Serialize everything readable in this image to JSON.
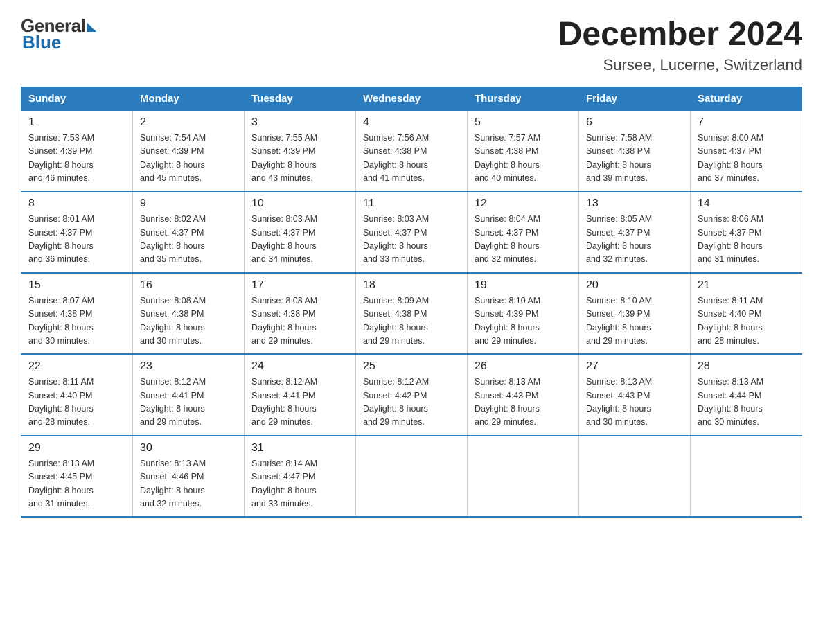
{
  "logo": {
    "general": "General",
    "blue": "Blue"
  },
  "header": {
    "month": "December 2024",
    "location": "Sursee, Lucerne, Switzerland"
  },
  "days_of_week": [
    "Sunday",
    "Monday",
    "Tuesday",
    "Wednesday",
    "Thursday",
    "Friday",
    "Saturday"
  ],
  "weeks": [
    [
      {
        "day": "1",
        "sunrise": "7:53 AM",
        "sunset": "4:39 PM",
        "daylight": "8 hours and 46 minutes."
      },
      {
        "day": "2",
        "sunrise": "7:54 AM",
        "sunset": "4:39 PM",
        "daylight": "8 hours and 45 minutes."
      },
      {
        "day": "3",
        "sunrise": "7:55 AM",
        "sunset": "4:39 PM",
        "daylight": "8 hours and 43 minutes."
      },
      {
        "day": "4",
        "sunrise": "7:56 AM",
        "sunset": "4:38 PM",
        "daylight": "8 hours and 41 minutes."
      },
      {
        "day": "5",
        "sunrise": "7:57 AM",
        "sunset": "4:38 PM",
        "daylight": "8 hours and 40 minutes."
      },
      {
        "day": "6",
        "sunrise": "7:58 AM",
        "sunset": "4:38 PM",
        "daylight": "8 hours and 39 minutes."
      },
      {
        "day": "7",
        "sunrise": "8:00 AM",
        "sunset": "4:37 PM",
        "daylight": "8 hours and 37 minutes."
      }
    ],
    [
      {
        "day": "8",
        "sunrise": "8:01 AM",
        "sunset": "4:37 PM",
        "daylight": "8 hours and 36 minutes."
      },
      {
        "day": "9",
        "sunrise": "8:02 AM",
        "sunset": "4:37 PM",
        "daylight": "8 hours and 35 minutes."
      },
      {
        "day": "10",
        "sunrise": "8:03 AM",
        "sunset": "4:37 PM",
        "daylight": "8 hours and 34 minutes."
      },
      {
        "day": "11",
        "sunrise": "8:03 AM",
        "sunset": "4:37 PM",
        "daylight": "8 hours and 33 minutes."
      },
      {
        "day": "12",
        "sunrise": "8:04 AM",
        "sunset": "4:37 PM",
        "daylight": "8 hours and 32 minutes."
      },
      {
        "day": "13",
        "sunrise": "8:05 AM",
        "sunset": "4:37 PM",
        "daylight": "8 hours and 32 minutes."
      },
      {
        "day": "14",
        "sunrise": "8:06 AM",
        "sunset": "4:37 PM",
        "daylight": "8 hours and 31 minutes."
      }
    ],
    [
      {
        "day": "15",
        "sunrise": "8:07 AM",
        "sunset": "4:38 PM",
        "daylight": "8 hours and 30 minutes."
      },
      {
        "day": "16",
        "sunrise": "8:08 AM",
        "sunset": "4:38 PM",
        "daylight": "8 hours and 30 minutes."
      },
      {
        "day": "17",
        "sunrise": "8:08 AM",
        "sunset": "4:38 PM",
        "daylight": "8 hours and 29 minutes."
      },
      {
        "day": "18",
        "sunrise": "8:09 AM",
        "sunset": "4:38 PM",
        "daylight": "8 hours and 29 minutes."
      },
      {
        "day": "19",
        "sunrise": "8:10 AM",
        "sunset": "4:39 PM",
        "daylight": "8 hours and 29 minutes."
      },
      {
        "day": "20",
        "sunrise": "8:10 AM",
        "sunset": "4:39 PM",
        "daylight": "8 hours and 29 minutes."
      },
      {
        "day": "21",
        "sunrise": "8:11 AM",
        "sunset": "4:40 PM",
        "daylight": "8 hours and 28 minutes."
      }
    ],
    [
      {
        "day": "22",
        "sunrise": "8:11 AM",
        "sunset": "4:40 PM",
        "daylight": "8 hours and 28 minutes."
      },
      {
        "day": "23",
        "sunrise": "8:12 AM",
        "sunset": "4:41 PM",
        "daylight": "8 hours and 29 minutes."
      },
      {
        "day": "24",
        "sunrise": "8:12 AM",
        "sunset": "4:41 PM",
        "daylight": "8 hours and 29 minutes."
      },
      {
        "day": "25",
        "sunrise": "8:12 AM",
        "sunset": "4:42 PM",
        "daylight": "8 hours and 29 minutes."
      },
      {
        "day": "26",
        "sunrise": "8:13 AM",
        "sunset": "4:43 PM",
        "daylight": "8 hours and 29 minutes."
      },
      {
        "day": "27",
        "sunrise": "8:13 AM",
        "sunset": "4:43 PM",
        "daylight": "8 hours and 30 minutes."
      },
      {
        "day": "28",
        "sunrise": "8:13 AM",
        "sunset": "4:44 PM",
        "daylight": "8 hours and 30 minutes."
      }
    ],
    [
      {
        "day": "29",
        "sunrise": "8:13 AM",
        "sunset": "4:45 PM",
        "daylight": "8 hours and 31 minutes."
      },
      {
        "day": "30",
        "sunrise": "8:13 AM",
        "sunset": "4:46 PM",
        "daylight": "8 hours and 32 minutes."
      },
      {
        "day": "31",
        "sunrise": "8:14 AM",
        "sunset": "4:47 PM",
        "daylight": "8 hours and 33 minutes."
      },
      null,
      null,
      null,
      null
    ]
  ],
  "labels": {
    "sunrise": "Sunrise: ",
    "sunset": "Sunset: ",
    "daylight": "Daylight: "
  }
}
